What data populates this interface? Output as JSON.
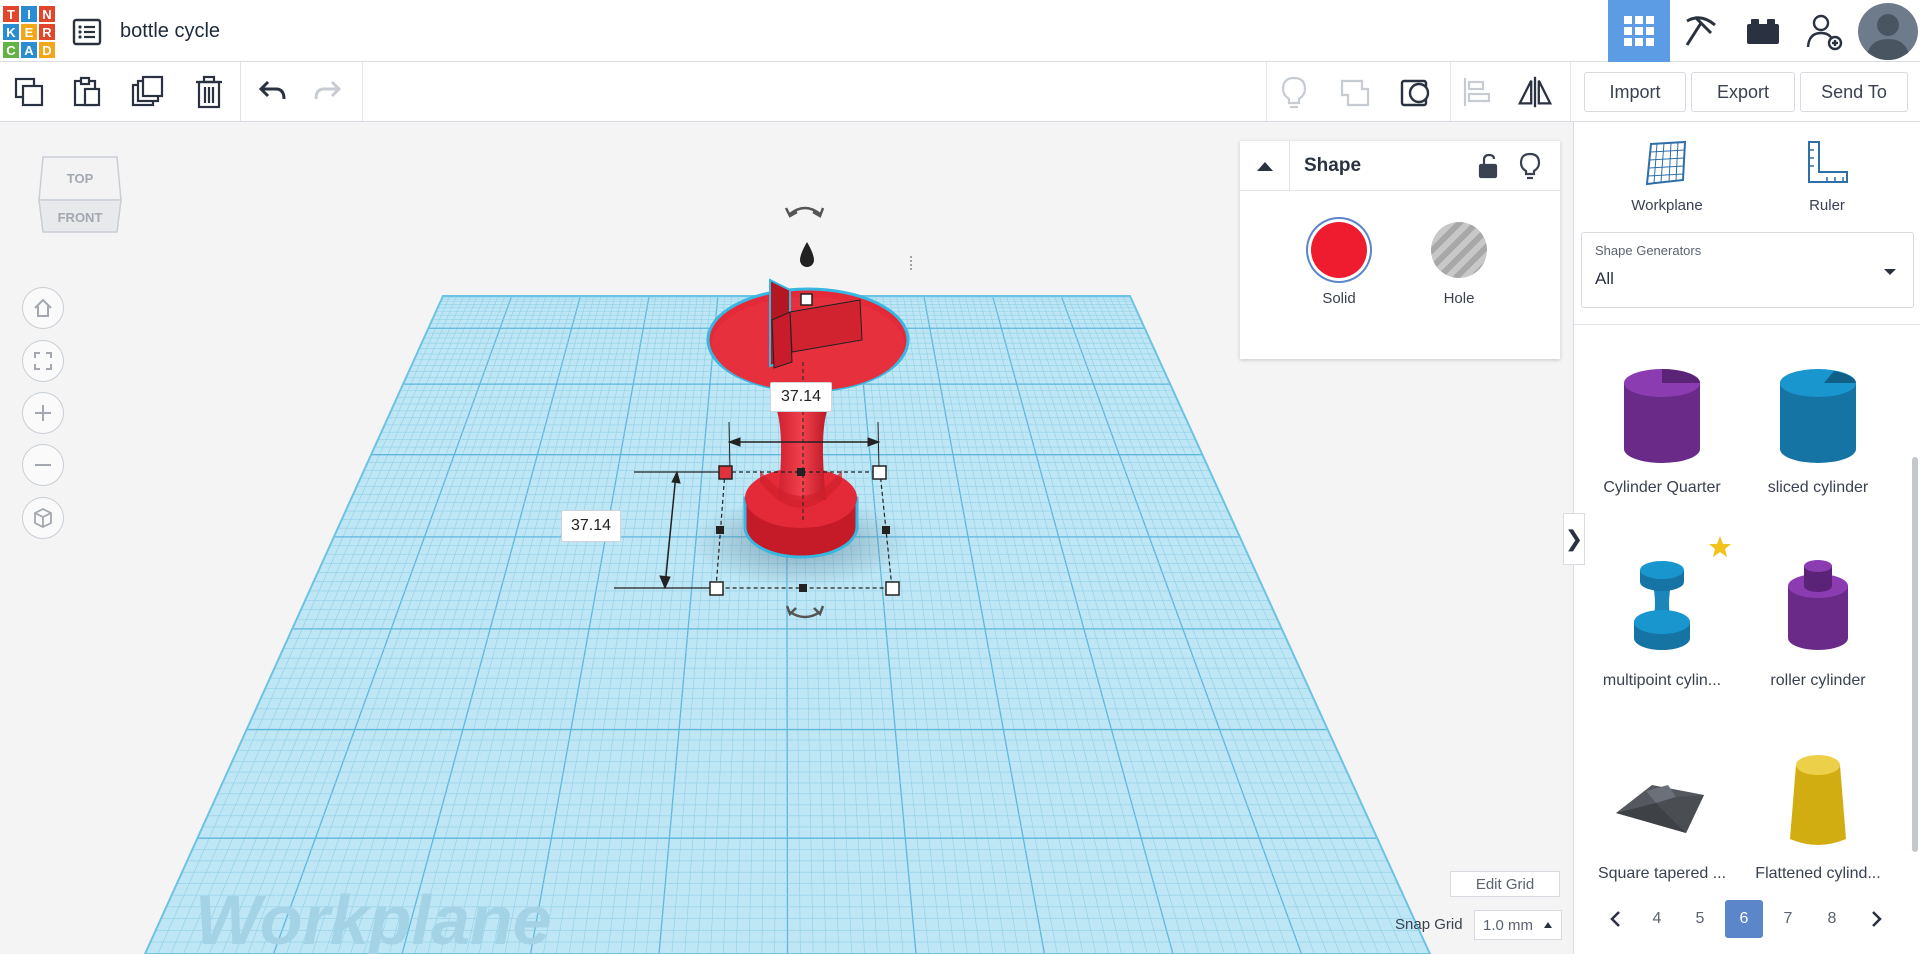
{
  "app": {
    "logo_letters": [
      "T",
      "I",
      "N",
      "K",
      "E",
      "R",
      "C",
      "A",
      "D"
    ],
    "design_title": "bottle cycle"
  },
  "topbar": {
    "icons": [
      "grid-view-icon",
      "pickaxe-icon",
      "bricks-icon",
      "invite-user-icon"
    ],
    "active_view": "3D design"
  },
  "toolbar": {
    "import_label": "Import",
    "export_label": "Export",
    "send_to_label": "Send To"
  },
  "viewcube": {
    "top": "TOP",
    "front": "FRONT"
  },
  "workplane": {
    "watermark": "Workplane",
    "dimension_top": "37.14",
    "dimension_left": "37.14"
  },
  "inspector": {
    "title": "Shape",
    "solid_label": "Solid",
    "hole_label": "Hole",
    "solid_color": "#ee1c2e"
  },
  "right_panel": {
    "workplane_label": "Workplane",
    "ruler_label": "Ruler",
    "shape_generators_label": "Shape Generators",
    "shape_generators_value": "All",
    "shapes": [
      {
        "name": "Cylinder Quarter",
        "color": "#6e2a8c"
      },
      {
        "name": "sliced cylinder",
        "color": "#1683b4"
      },
      {
        "name": "multipoint cylin...",
        "color": "#1683b4"
      },
      {
        "name": "roller cylinder",
        "color": "#6e2a8c"
      },
      {
        "name": "Square tapered ...",
        "color": "#4a4d52"
      },
      {
        "name": "Flattened cylind...",
        "color": "#e8c21c"
      }
    ],
    "pages": [
      "4",
      "5",
      "6",
      "7",
      "8"
    ],
    "current_page": "6"
  },
  "grid_controls": {
    "edit_grid_label": "Edit Grid",
    "snap_grid_label": "Snap Grid",
    "snap_grid_value": "1.0 mm"
  }
}
